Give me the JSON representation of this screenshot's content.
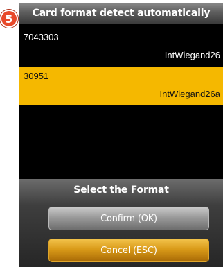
{
  "step_badge": "5",
  "title": "Card format detect automatically",
  "cards": [
    {
      "number": "7043303",
      "format": "IntWiegand26",
      "selected": false
    },
    {
      "number": "30951",
      "format": "IntWiegand26a",
      "selected": true
    }
  ],
  "dialog": {
    "title": "Select the Format",
    "confirm_label": "Confirm (OK)",
    "cancel_label": "Cancel (ESC)"
  },
  "colors": {
    "selected_row": "#f5b800",
    "step_badge": "#e8492a",
    "cancel_button": "#d99a18",
    "confirm_button": "#9a9a9a"
  }
}
